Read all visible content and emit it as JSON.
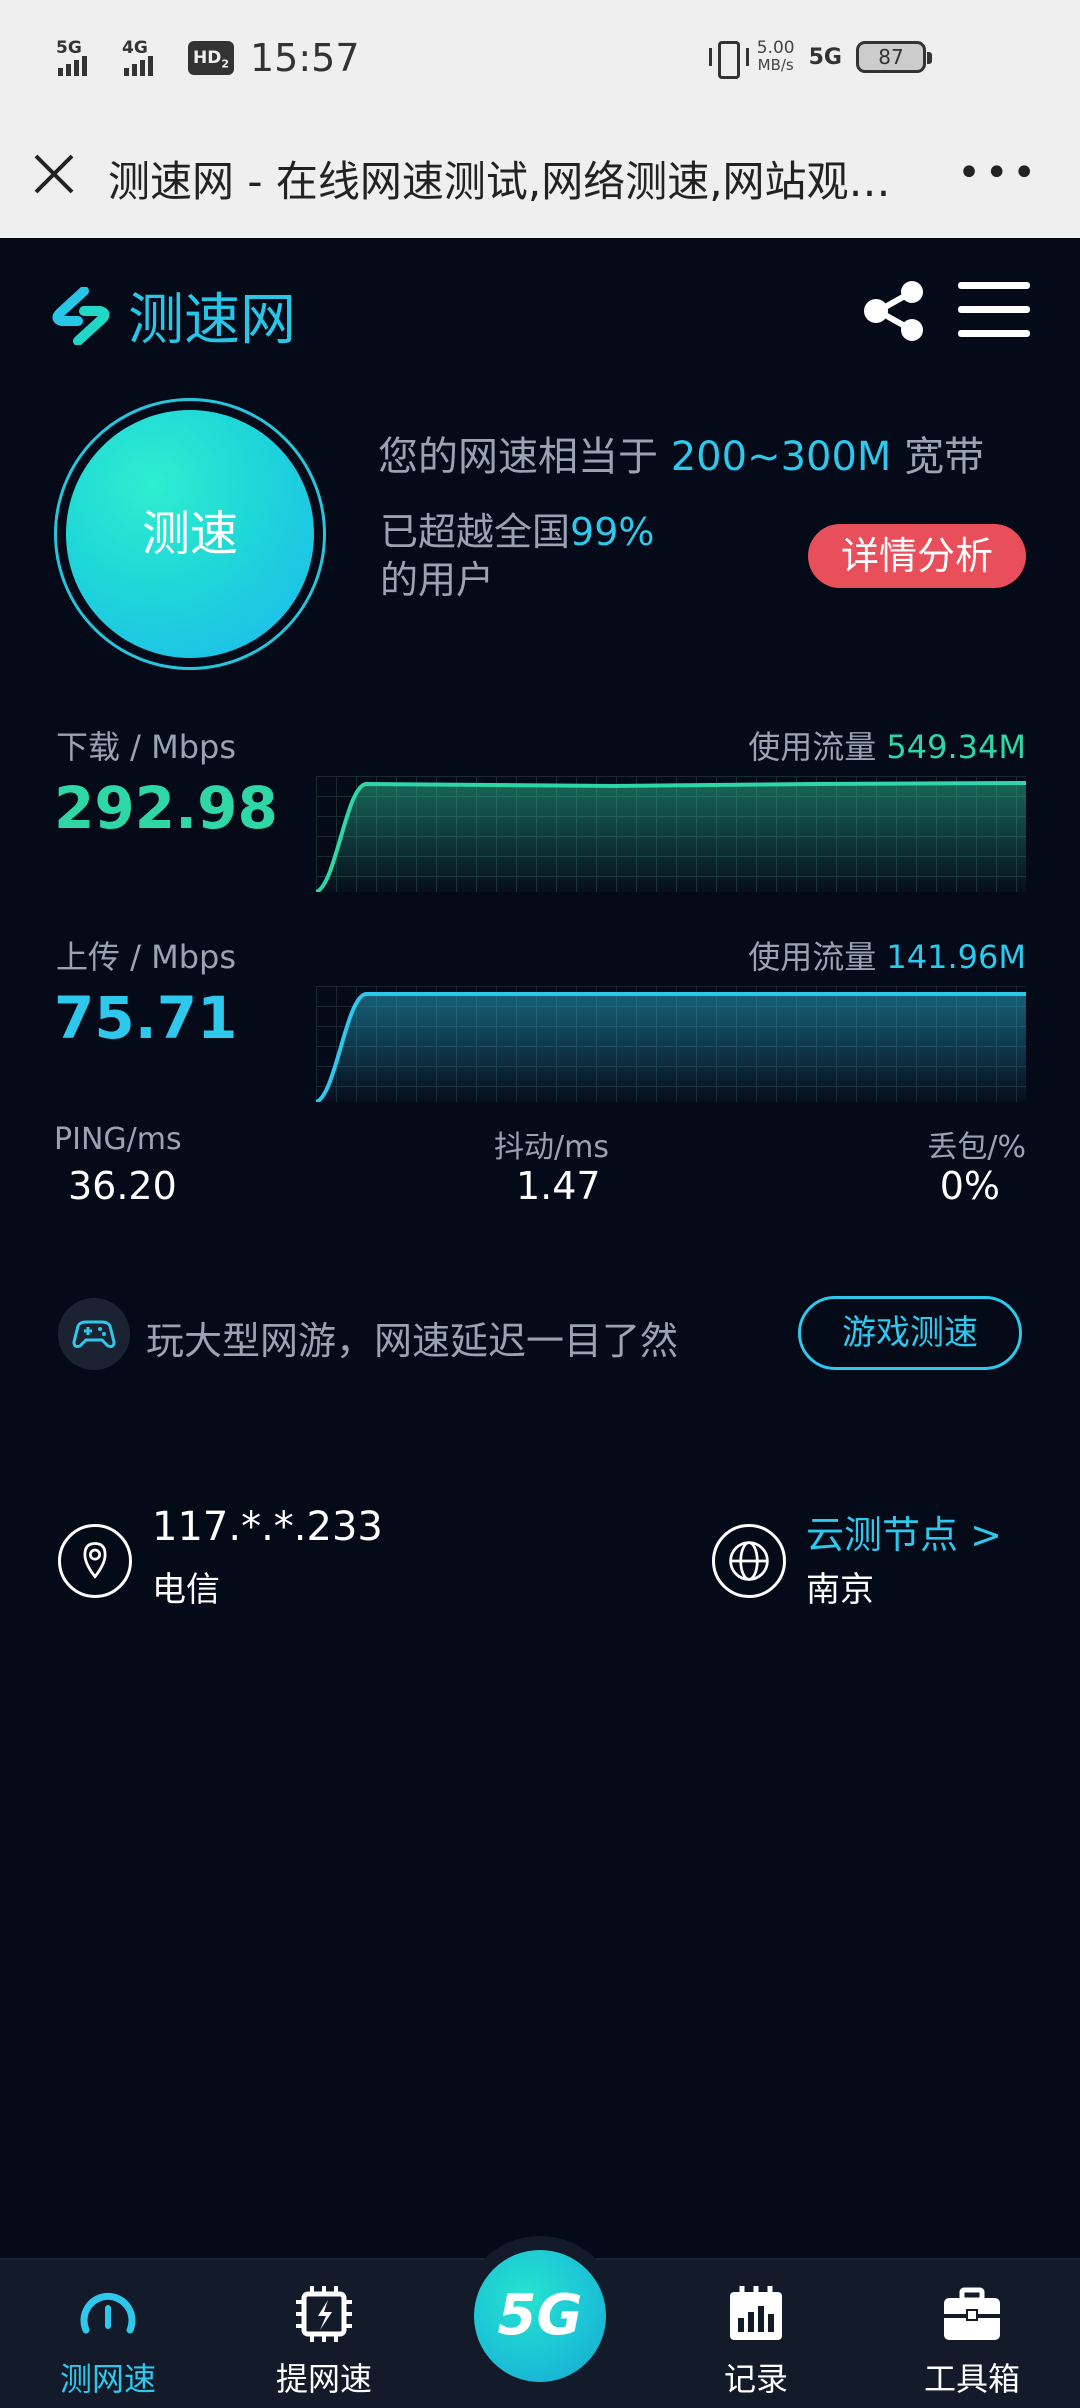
{
  "status_bar": {
    "net1": "5G",
    "net2": "4G",
    "hd": "HD",
    "hd_sub": "2",
    "time": "15:57",
    "speed_value": "5.00",
    "speed_unit": "MB/s",
    "net_type": "5G",
    "battery": "87"
  },
  "browser": {
    "title": "测速网 - 在线网速测试,网络测速,网站观…",
    "more": "•••"
  },
  "app": {
    "logo_text": "测速网"
  },
  "result": {
    "gauge_label": "测速",
    "equiv_prefix": "您的网速相当于 ",
    "equiv_range": "200~300M",
    "equiv_suffix": " 宽带",
    "surpass_prefix": "已超越全国",
    "surpass_percent": "99%",
    "surpass_suffix": "的用户",
    "detail_button": "详情分析"
  },
  "download": {
    "label": "下载 / Mbps",
    "value": "292.98",
    "usage_label": "使用流量 ",
    "usage_value": "549.34M",
    "color": "#2fd6a6"
  },
  "upload": {
    "label": "上传 / Mbps",
    "value": "75.71",
    "usage_label": "使用流量 ",
    "usage_value": "141.96M",
    "color": "#2ec8ec"
  },
  "stats": {
    "ping_label": "PING/ms",
    "ping_value": "36.20",
    "jitter_label": "抖动/ms",
    "jitter_value": "1.47",
    "loss_label": "丢包/%",
    "loss_value": "0%"
  },
  "game": {
    "text": "玩大型网游，网速延迟一目了然",
    "button": "游戏测速"
  },
  "connection": {
    "ip": "117.*.*.233",
    "isp": "电信",
    "node_title": "云测节点 >",
    "node_city": "南京"
  },
  "nav": {
    "items": [
      {
        "label": "测网速",
        "icon": "speedometer-icon"
      },
      {
        "label": "提网速",
        "icon": "chip-bolt-icon"
      },
      {
        "label": "5G",
        "icon": "5g-icon"
      },
      {
        "label": "记录",
        "icon": "calendar-chart-icon"
      },
      {
        "label": "工具箱",
        "icon": "toolbox-icon"
      }
    ]
  },
  "colors": {
    "accent": "#2ec8ec",
    "green": "#2fd6a6",
    "danger": "#e94f5a",
    "background": "#050a18"
  }
}
